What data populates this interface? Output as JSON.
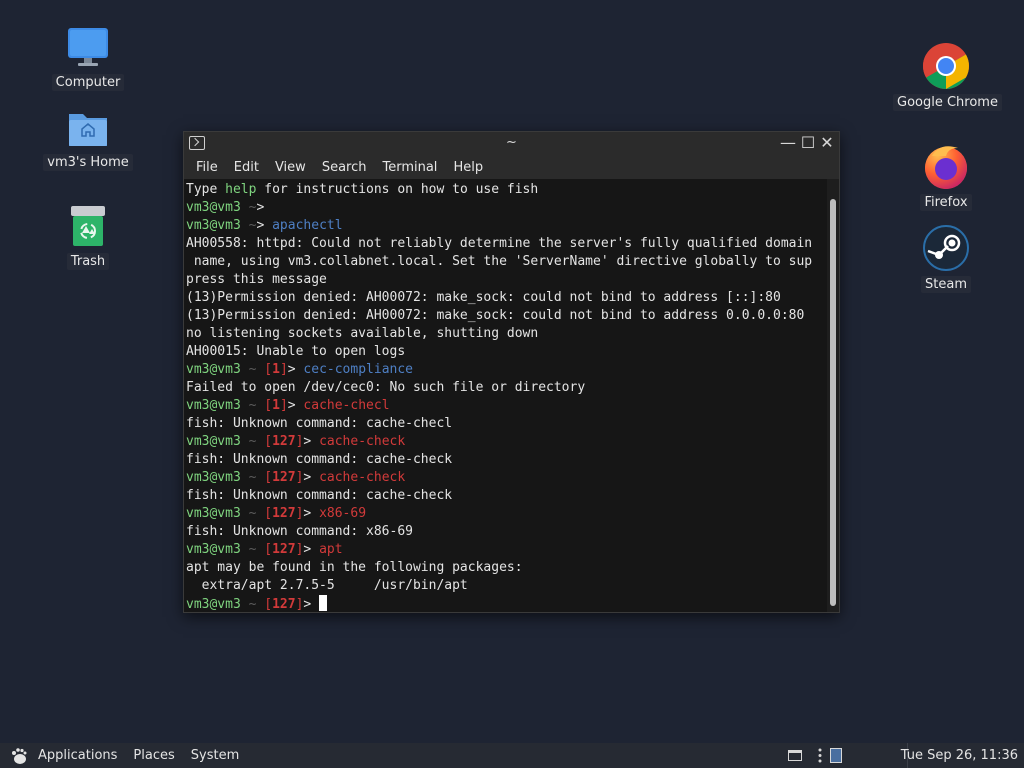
{
  "desktop": {
    "icons_left": [
      {
        "label": "Computer",
        "icon": "computer-icon"
      },
      {
        "label": "vm3's Home",
        "icon": "home-folder-icon"
      },
      {
        "label": "Trash",
        "icon": "trash-icon"
      }
    ],
    "icons_right": [
      {
        "label": "Google Chrome",
        "icon": "chrome-icon"
      },
      {
        "label": "Firefox",
        "icon": "firefox-icon"
      },
      {
        "label": "Steam",
        "icon": "steam-icon"
      }
    ]
  },
  "terminal": {
    "title": "~",
    "controls": {
      "minimize": "—",
      "maximize": "☐",
      "close": "✕"
    },
    "menu": [
      "File",
      "Edit",
      "View",
      "Search",
      "Terminal",
      "Help"
    ],
    "colors": {
      "prompt_user": "#7fd47f",
      "command_ok": "#4e7fc4",
      "command_err": "#d23a3a",
      "background": "#161616"
    },
    "lines": [
      [
        {
          "t": "Type "
        },
        {
          "t": "help",
          "c": "g"
        },
        {
          "t": " for instructions on how to use fish"
        }
      ],
      [
        {
          "t": "vm3@vm3",
          "c": "g"
        },
        {
          "t": " ~",
          "c": "d"
        },
        {
          "t": ">"
        }
      ],
      [
        {
          "t": "vm3@vm3",
          "c": "g"
        },
        {
          "t": " ~",
          "c": "d"
        },
        {
          "t": "> "
        },
        {
          "t": "apachectl",
          "c": "b"
        }
      ],
      [
        {
          "t": "AH00558: httpd: Could not reliably determine the server's fully qualified domain"
        }
      ],
      [
        {
          "t": " name, using vm3.collabnet.local. Set the 'ServerName' directive globally to sup"
        }
      ],
      [
        {
          "t": "press this message"
        }
      ],
      [
        {
          "t": "(13)Permission denied: AH00072: make_sock: could not bind to address [::]:80"
        }
      ],
      [
        {
          "t": "(13)Permission denied: AH00072: make_sock: could not bind to address 0.0.0.0:80"
        }
      ],
      [
        {
          "t": "no listening sockets available, shutting down"
        }
      ],
      [
        {
          "t": "AH00015: Unable to open logs"
        }
      ],
      [
        {
          "t": "vm3@vm3",
          "c": "g"
        },
        {
          "t": " ~ ",
          "c": "d"
        },
        {
          "t": "[",
          "c": "r"
        },
        {
          "t": "1",
          "c": "rb"
        },
        {
          "t": "]",
          "c": "r"
        },
        {
          "t": "> "
        },
        {
          "t": "cec-compliance",
          "c": "b"
        }
      ],
      [
        {
          "t": "Failed to open /dev/cec0: No such file or directory"
        }
      ],
      [
        {
          "t": "vm3@vm3",
          "c": "g"
        },
        {
          "t": " ~ ",
          "c": "d"
        },
        {
          "t": "[",
          "c": "r"
        },
        {
          "t": "1",
          "c": "rb"
        },
        {
          "t": "]",
          "c": "r"
        },
        {
          "t": "> "
        },
        {
          "t": "cache-checl",
          "c": "r"
        }
      ],
      [
        {
          "t": "fish: Unknown command: cache-checl"
        }
      ],
      [
        {
          "t": "vm3@vm3",
          "c": "g"
        },
        {
          "t": " ~ ",
          "c": "d"
        },
        {
          "t": "[",
          "c": "r"
        },
        {
          "t": "127",
          "c": "rb"
        },
        {
          "t": "]",
          "c": "r"
        },
        {
          "t": "> "
        },
        {
          "t": "cache-check",
          "c": "r"
        }
      ],
      [
        {
          "t": "fish: Unknown command: cache-check"
        }
      ],
      [
        {
          "t": "vm3@vm3",
          "c": "g"
        },
        {
          "t": " ~ ",
          "c": "d"
        },
        {
          "t": "[",
          "c": "r"
        },
        {
          "t": "127",
          "c": "rb"
        },
        {
          "t": "]",
          "c": "r"
        },
        {
          "t": "> "
        },
        {
          "t": "cache-check",
          "c": "r"
        }
      ],
      [
        {
          "t": "fish: Unknown command: cache-check"
        }
      ],
      [
        {
          "t": "vm3@vm3",
          "c": "g"
        },
        {
          "t": " ~ ",
          "c": "d"
        },
        {
          "t": "[",
          "c": "r"
        },
        {
          "t": "127",
          "c": "rb"
        },
        {
          "t": "]",
          "c": "r"
        },
        {
          "t": "> "
        },
        {
          "t": "x86-69",
          "c": "r"
        }
      ],
      [
        {
          "t": "fish: Unknown command: x86-69"
        }
      ],
      [
        {
          "t": "vm3@vm3",
          "c": "g"
        },
        {
          "t": " ~ ",
          "c": "d"
        },
        {
          "t": "[",
          "c": "r"
        },
        {
          "t": "127",
          "c": "rb"
        },
        {
          "t": "]",
          "c": "r"
        },
        {
          "t": "> "
        },
        {
          "t": "apt",
          "c": "r"
        }
      ],
      [
        {
          "t": "apt may be found in the following packages:"
        }
      ],
      [
        {
          "t": "  extra/apt 2.7.5-5     /usr/bin/apt"
        }
      ],
      [
        {
          "t": "vm3@vm3",
          "c": "g"
        },
        {
          "t": " ~ ",
          "c": "d"
        },
        {
          "t": "[",
          "c": "r"
        },
        {
          "t": "127",
          "c": "rb"
        },
        {
          "t": "]",
          "c": "r"
        },
        {
          "t": "> "
        },
        {
          "cursor": true
        }
      ]
    ]
  },
  "panel": {
    "menus": [
      "Applications",
      "Places",
      "System"
    ],
    "clock": "Tue Sep 26, 11:36"
  }
}
